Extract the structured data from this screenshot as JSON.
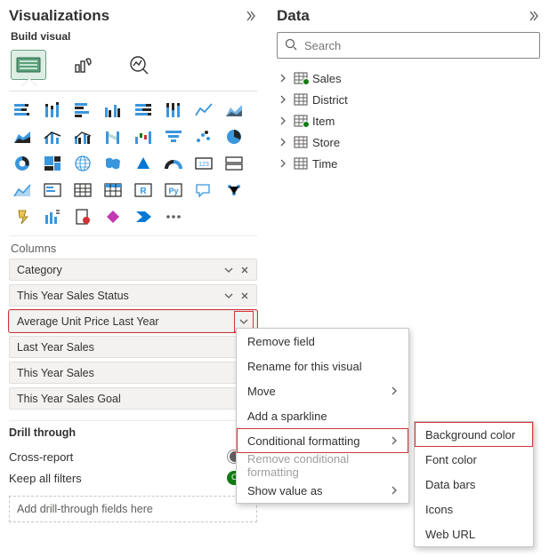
{
  "viz_pane": {
    "title": "Visualizations",
    "subtitle": "Build visual",
    "columns_label": "Columns",
    "fields": [
      {
        "label": "Category",
        "removable": true
      },
      {
        "label": "This Year Sales Status",
        "removable": true
      },
      {
        "label": "Average Unit Price Last Year",
        "removable": false,
        "highlighted": true
      },
      {
        "label": "Last Year Sales",
        "removable": false
      },
      {
        "label": "This Year Sales",
        "removable": false
      },
      {
        "label": "This Year Sales Goal",
        "removable": false
      }
    ],
    "drill": {
      "header": "Drill through",
      "cross_report_label": "Cross-report",
      "cross_report_state": "Off",
      "keep_filters_label": "Keep all filters",
      "keep_filters_state": "On",
      "drop_hint": "Add drill-through fields here"
    }
  },
  "data_pane": {
    "title": "Data",
    "search_placeholder": "Search",
    "tables": [
      {
        "name": "Sales",
        "checked": true
      },
      {
        "name": "District",
        "checked": false
      },
      {
        "name": "Item",
        "checked": true
      },
      {
        "name": "Store",
        "checked": false
      },
      {
        "name": "Time",
        "checked": false
      }
    ]
  },
  "context_menu": {
    "items": [
      {
        "label": "Remove field",
        "submenu": false
      },
      {
        "label": "Rename for this visual",
        "submenu": false
      },
      {
        "label": "Move",
        "submenu": true
      },
      {
        "label": "Add a sparkline",
        "submenu": false
      },
      {
        "label": "Conditional formatting",
        "submenu": true,
        "highlighted": true
      },
      {
        "label": "Remove conditional formatting",
        "submenu": false,
        "disabled": true
      },
      {
        "label": "Show value as",
        "submenu": true
      }
    ]
  },
  "submenu": {
    "items": [
      {
        "label": "Background color",
        "highlighted": true
      },
      {
        "label": "Font color"
      },
      {
        "label": "Data bars"
      },
      {
        "label": "Icons"
      },
      {
        "label": "Web URL"
      }
    ]
  }
}
